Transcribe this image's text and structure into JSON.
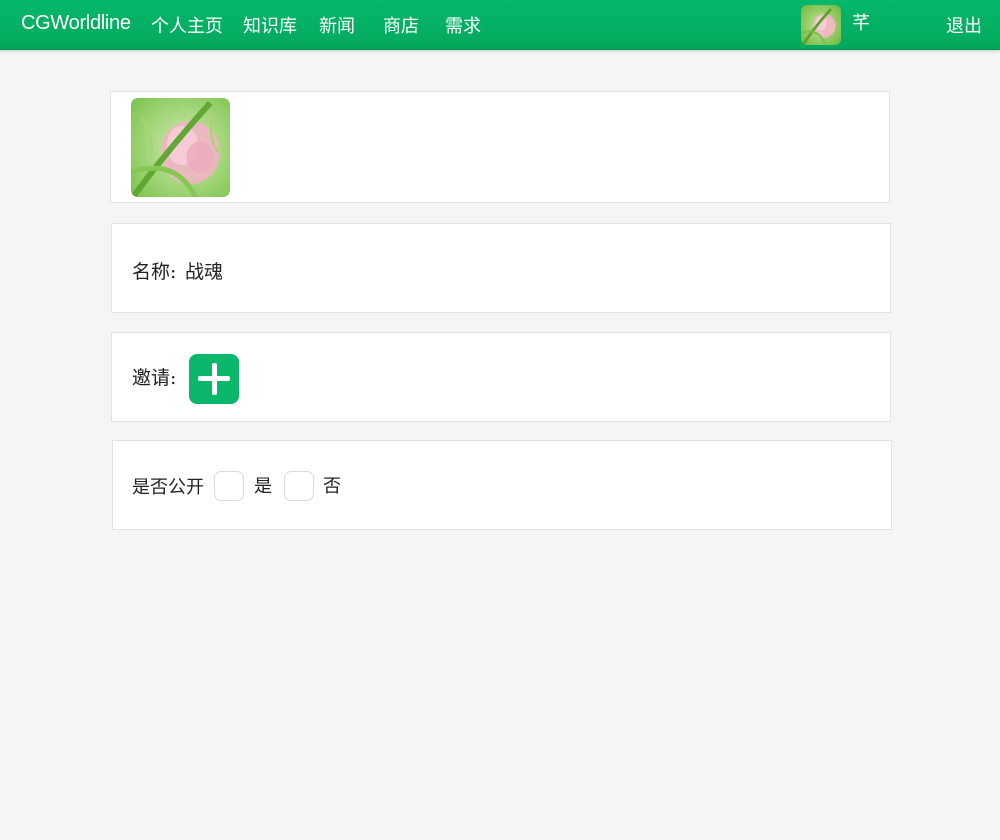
{
  "navbar": {
    "brand": "CGWorldline",
    "items": [
      "个人主页",
      "知识库",
      "新闻",
      "商店",
      "需求"
    ],
    "username": "芊",
    "logout": "退出"
  },
  "form": {
    "name_label": "名称:",
    "name_value": "战魂",
    "invite_label": "邀请:",
    "public_label": "是否公开",
    "option_yes": "是",
    "option_no": "否"
  },
  "icons": {
    "add": "plus-icon",
    "avatar": "flower-avatar-image"
  },
  "colors": {
    "nav_green": "#06b86a",
    "accent_green": "#0bb76a",
    "page_bg": "#f4f5f5"
  }
}
